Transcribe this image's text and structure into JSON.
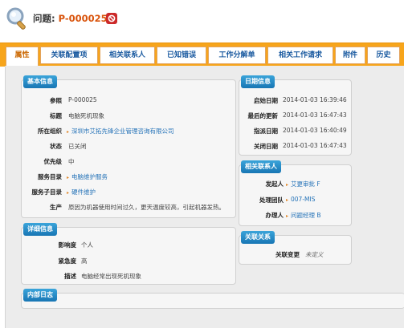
{
  "header": {
    "label": "问题:",
    "id": "P-000025"
  },
  "tabs": [
    {
      "label": "属性",
      "active": true
    },
    {
      "label": "关联配置项"
    },
    {
      "label": "相关联系人"
    },
    {
      "label": "已知错误"
    },
    {
      "label": "工作分解单"
    },
    {
      "label": "相关工作请求"
    },
    {
      "label": "附件"
    },
    {
      "label": "历史"
    }
  ],
  "basic_info": {
    "title": "基本信息",
    "rows": [
      {
        "label": "参照",
        "value": "P-000025"
      },
      {
        "label": "标题",
        "value": "电脑死机现象"
      },
      {
        "label": "所在组织",
        "value": "深圳市艾拓先锋企业管理咨询有限公司"
      },
      {
        "label": "状态",
        "value": "已关闭"
      },
      {
        "label": "优先级",
        "value": "中"
      },
      {
        "label": "服务目录",
        "value": "电脑维护服务"
      },
      {
        "label": "服务子目录",
        "value": "硬件维护"
      },
      {
        "label": "生产",
        "value": "原因为机器使用时间过久，更天温度较高，引起机器发热。"
      }
    ]
  },
  "detail_info": {
    "title": "详细信息",
    "rows": [
      {
        "label": "影响度",
        "value": "个人"
      },
      {
        "label": "紧急度",
        "value": "高"
      },
      {
        "label": "描述",
        "value": "电脑经常出现死机现象"
      }
    ]
  },
  "date_info": {
    "title": "日期信息",
    "rows": [
      {
        "label": "启始日期",
        "value": "2014-01-03 16:39:46"
      },
      {
        "label": "最后的更新",
        "value": "2014-01-03 16:47:43"
      },
      {
        "label": "指派日期",
        "value": "2014-01-03 16:40:49"
      },
      {
        "label": "关闭日期",
        "value": "2014-01-03 16:47:43"
      }
    ]
  },
  "contacts": {
    "title": "相关联系人",
    "rows": [
      {
        "label": "发起人",
        "value": "艾更审批 F"
      },
      {
        "label": "处理团队",
        "value": "007-MIS"
      },
      {
        "label": "办理人",
        "value": "问题经理 B"
      }
    ]
  },
  "relations": {
    "title": "关联关系",
    "rows": [
      {
        "label": "关联变更",
        "value": "未定义"
      }
    ]
  },
  "internal_log": {
    "title": "内部日志"
  },
  "colors": {
    "tab_bar": "#f7a51b",
    "panel_title": "#1876b4",
    "link": "#2573b8",
    "id": "#d9530b"
  },
  "icons": [
    "magnifier-icon",
    "close-icon",
    "bullet-arrow-icon"
  ]
}
